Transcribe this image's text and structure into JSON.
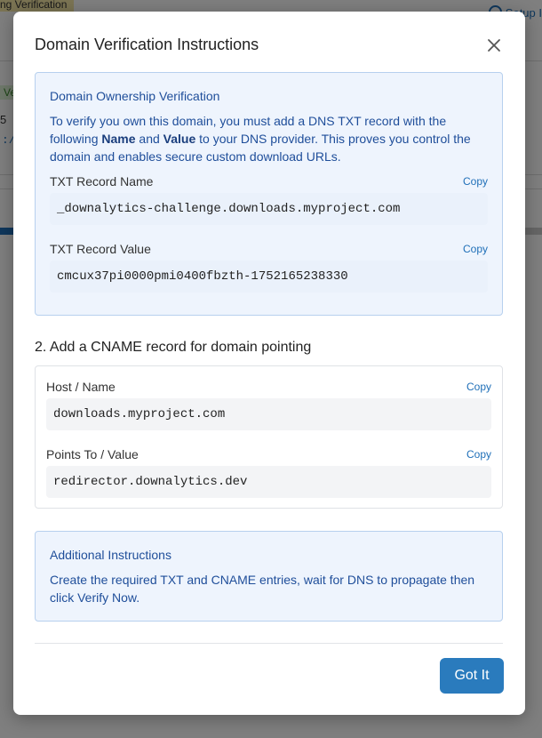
{
  "background": {
    "status_pill": "ng Verification",
    "help_link": "Setup I",
    "badge": "Ve",
    "number": "5",
    "code_fragment": ":/"
  },
  "modal": {
    "title": "Domain Verification Instructions",
    "ownership": {
      "title": "Domain Ownership Verification",
      "text_before": "To verify you own this domain, you must add a DNS TXT record with the following ",
      "bold_name": "Name",
      "text_and": " and ",
      "bold_value": "Value",
      "text_after": " to your DNS provider. This proves you control the domain and enables secure custom download URLs.",
      "txt_name_label": "TXT Record Name",
      "txt_name_value": "_downalytics-challenge.downloads.myproject.com",
      "txt_value_label": "TXT Record Value",
      "txt_value_value": "cmcux37pi0000pmi0400fbzth-1752165238330",
      "copy_label": "Copy"
    },
    "cname": {
      "section_title": "2. Add a CNAME record for domain pointing",
      "host_label": "Host / Name",
      "host_value": "downloads.myproject.com",
      "points_label": "Points To / Value",
      "points_value": "redirector.downalytics.dev",
      "copy_label": "Copy"
    },
    "additional": {
      "title": "Additional Instructions",
      "text": "Create the required TXT and CNAME entries, wait for DNS to propagate then click Verify Now."
    },
    "got_it_label": "Got It"
  },
  "colors": {
    "accent": "#2a7bbd",
    "info_bg": "#eef4fd",
    "info_border": "#b7d0ee",
    "info_text": "#1f4e9a"
  },
  "icons": {
    "close": "close-icon",
    "help": "help-circle-icon"
  }
}
